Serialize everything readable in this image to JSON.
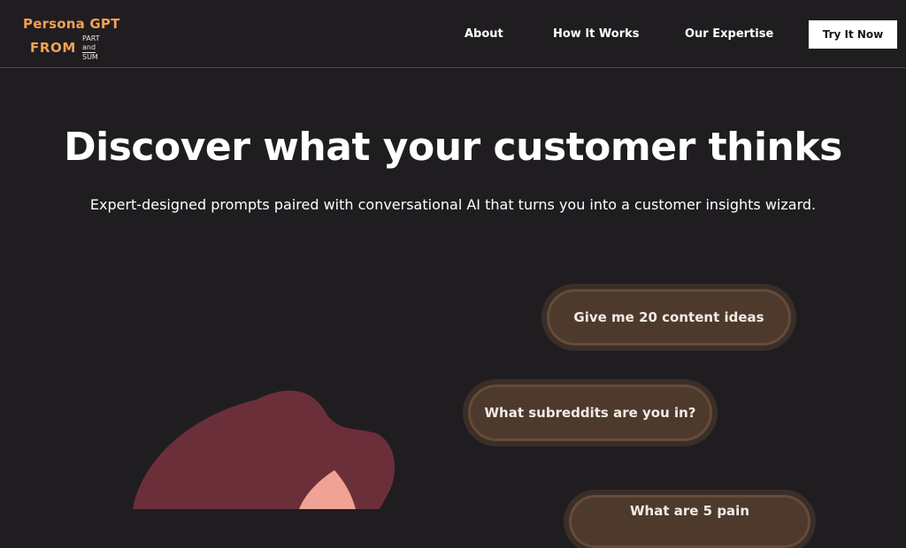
{
  "logo": {
    "line1": "Persona GPT",
    "from": "FROM",
    "part": "PART",
    "and": "and",
    "sum": "SUM"
  },
  "nav": {
    "items": [
      {
        "label": "About"
      },
      {
        "label": "How It Works"
      },
      {
        "label": "Our Expertise"
      }
    ],
    "cta_label": "Try It Now"
  },
  "hero": {
    "headline": "Discover what your customer thinks",
    "subheadline": "Expert-designed prompts paired with conversational AI that turns you into a customer insights wizard."
  },
  "prompts": [
    {
      "text": "Give me 20 content ideas"
    },
    {
      "text": "What subreddits are you in?"
    },
    {
      "text": "What are 5 pain"
    }
  ],
  "colors": {
    "background": "#201d21",
    "brand_orange": "#f1a154",
    "bubble_fill": "#4d3a2d",
    "hair": "#6b2f3a",
    "skin": "#f0a394"
  }
}
